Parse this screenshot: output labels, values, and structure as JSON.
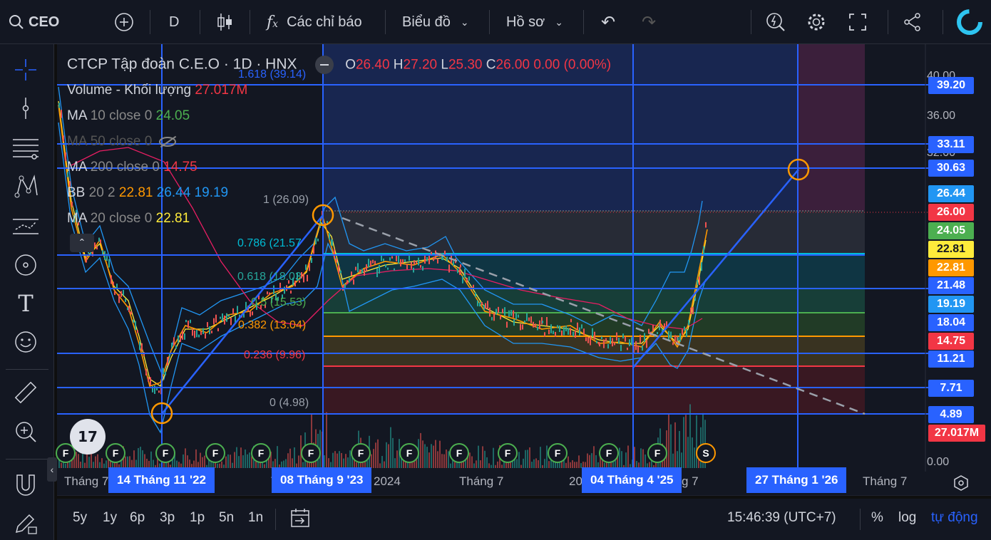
{
  "toolbar": {
    "symbol": "CEO",
    "interval": "D",
    "indicators": "Các chỉ báo",
    "chart_menu": "Biểu đồ",
    "profile_menu": "Hồ sơ"
  },
  "legend": {
    "title": "CTCP Tập đoàn C.E.O · 1D · HNX",
    "o_label": "O",
    "o": "26.40",
    "h_label": "H",
    "h": "27.20",
    "l_label": "L",
    "l": "25.30",
    "c_label": "C",
    "c": "26.00",
    "change": "0.00 (0.00%)",
    "volume_label": "Volume - Khối lượng",
    "volume": "27.017M",
    "ma10_label": "MA",
    "ma10_params": "10 close 0",
    "ma10": "24.05",
    "ma50_label": "MA 50 close 0",
    "ma200_label": "MA",
    "ma200_params": "200 close 0",
    "ma200": "14.75",
    "bb_label": "BB",
    "bb_params": "20 2",
    "bb_mid": "22.81",
    "bb_up": "26.44",
    "bb_low": "19.19",
    "ma20_label": "MA",
    "ma20_params": "20 close 0",
    "ma20": "22.81"
  },
  "fib": {
    "f1618": "1.618 (39.14)",
    "f1": "1 (26.09)",
    "f786": "0.786 (21.57",
    "f618": "0.618 (18.03",
    "f5": "0.5 (15.53)",
    "f382": "0.382 (13.04)",
    "f236": "0.236 (9.96)",
    "f0": "0 (4.98)"
  },
  "price_axis": {
    "t40": "40.00",
    "t36": "36.00",
    "t32": "32.00",
    "t0": "0.00"
  },
  "price_labels": {
    "p3920": "39.20",
    "p3311": "33.11",
    "p3063": "30.63",
    "p2644": "26.44",
    "p2600": "26.00",
    "p2405": "24.05",
    "p2281a": "22.81",
    "p2281b": "22.81",
    "p2148": "21.48",
    "p1919": "19.19",
    "p1804": "18.04",
    "p1475": "14.75",
    "p1121": "11.21",
    "p771": "7.71",
    "p489": "4.89",
    "vol": "27.017M"
  },
  "time_axis": {
    "t1": "Tháng 7",
    "t2": "Th",
    "t3": "2024",
    "t4": "Tháng 7",
    "t5": "20",
    "t6": "g 7",
    "t7": "Tháng 7"
  },
  "time_cursors": {
    "c1": "14 Tháng 11 '22",
    "c2": "08 Tháng 9 '23",
    "c3": "04 Tháng 4 '25",
    "c4": "27 Tháng 1 '26"
  },
  "bottom": {
    "r5y": "5y",
    "r1y": "1y",
    "r6p": "6p",
    "r3p": "3p",
    "r1p": "1p",
    "r5n": "5n",
    "r1n": "1n",
    "time": "15:46:39 (UTC+7)",
    "pct": "%",
    "log": "log",
    "auto": "tự động"
  },
  "events": {
    "f": "F",
    "s": "S"
  },
  "colors": {
    "blue": "#2962ff",
    "red": "#f23645",
    "green": "#4caf50",
    "orange": "#ff9800",
    "yellow": "#ffeb3b"
  }
}
